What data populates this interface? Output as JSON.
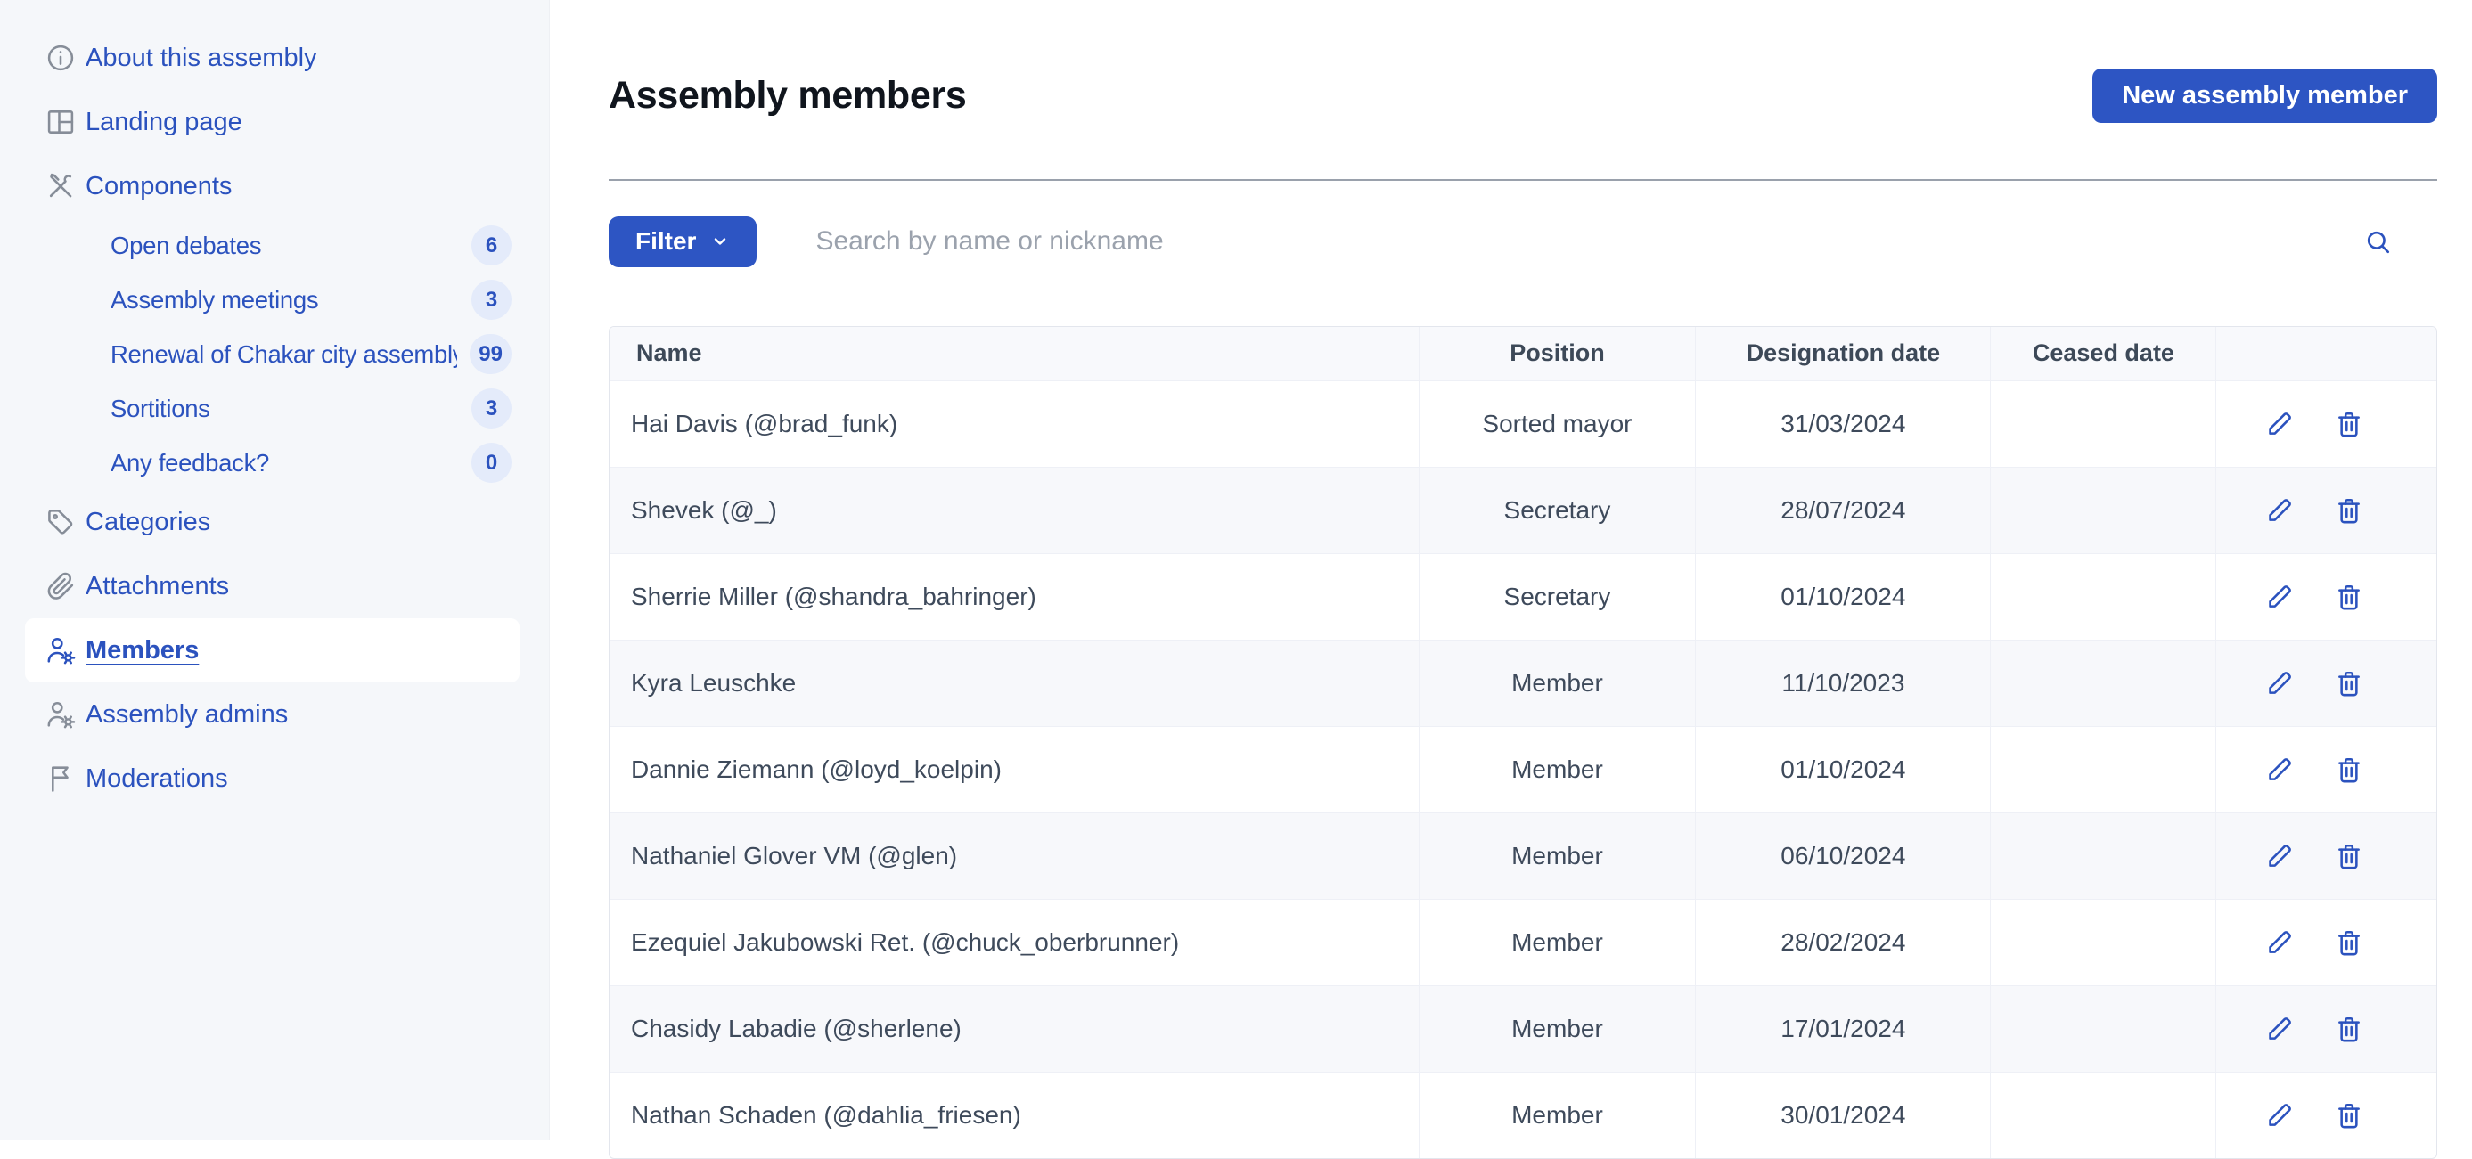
{
  "colors": {
    "primary_button": "#2d55c3",
    "link_blue": "#2b52be",
    "sidebar_bg": "#f5f7fa",
    "row_alt_bg": "#f7f8fb",
    "text_dark": "#3e4a5b"
  },
  "sidebar": {
    "items": [
      {
        "label": "About this assembly",
        "icon": "info-icon"
      },
      {
        "label": "Landing page",
        "icon": "landing-page-icon"
      },
      {
        "label": "Components",
        "icon": "tools-icon"
      },
      {
        "label": "Open debates",
        "badge": "6"
      },
      {
        "label": "Assembly meetings",
        "badge": "3"
      },
      {
        "label": "Renewal of Chakar city assembly",
        "badge": "99"
      },
      {
        "label": "Sortitions",
        "badge": "3"
      },
      {
        "label": "Any feedback?",
        "badge": "0"
      },
      {
        "label": "Categories",
        "icon": "tag-icon"
      },
      {
        "label": "Attachments",
        "icon": "paperclip-icon"
      },
      {
        "label": "Members",
        "icon": "member-gear-icon",
        "active": true
      },
      {
        "label": "Assembly admins",
        "icon": "member-gear-icon"
      },
      {
        "label": "Moderations",
        "icon": "flag-icon"
      }
    ]
  },
  "header": {
    "title": "Assembly members",
    "new_button_label": "New assembly member"
  },
  "toolbar": {
    "filter_label": "Filter",
    "search_placeholder": "Search by name or nickname"
  },
  "table": {
    "columns": [
      "Name",
      "Position",
      "Designation date",
      "Ceased date",
      ""
    ],
    "rows": [
      {
        "name": "Hai Davis (@brad_funk)",
        "position": "Sorted mayor",
        "designation_date": "31/03/2024",
        "ceased_date": ""
      },
      {
        "name": "Shevek (@_)",
        "position": "Secretary",
        "designation_date": "28/07/2024",
        "ceased_date": ""
      },
      {
        "name": "Sherrie Miller (@shandra_bahringer)",
        "position": "Secretary",
        "designation_date": "01/10/2024",
        "ceased_date": ""
      },
      {
        "name": "Kyra Leuschke",
        "position": "Member",
        "designation_date": "11/10/2023",
        "ceased_date": ""
      },
      {
        "name": "Dannie Ziemann (@loyd_koelpin)",
        "position": "Member",
        "designation_date": "01/10/2024",
        "ceased_date": ""
      },
      {
        "name": "Nathaniel Glover VM (@glen)",
        "position": "Member",
        "designation_date": "06/10/2024",
        "ceased_date": ""
      },
      {
        "name": "Ezequiel Jakubowski Ret. (@chuck_oberbrunner)",
        "position": "Member",
        "designation_date": "28/02/2024",
        "ceased_date": ""
      },
      {
        "name": "Chasidy Labadie (@sherlene)",
        "position": "Member",
        "designation_date": "17/01/2024",
        "ceased_date": ""
      },
      {
        "name": "Nathan Schaden (@dahlia_friesen)",
        "position": "Member",
        "designation_date": "30/01/2024",
        "ceased_date": ""
      }
    ]
  }
}
